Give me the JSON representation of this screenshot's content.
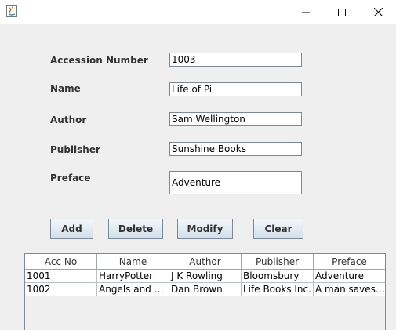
{
  "form": {
    "accession_label": "Accession Number",
    "accession_value": "1003",
    "name_label": "Name",
    "name_value": "Life of Pi",
    "author_label": "Author",
    "author_value": "Sam Wellington",
    "publisher_label": "Publisher",
    "publisher_value": "Sunshine Books",
    "preface_label": "Preface",
    "preface_value": "Adventure"
  },
  "buttons": {
    "add": "Add",
    "delete": "Delete",
    "modify": "Modify",
    "clear": "Clear"
  },
  "table": {
    "columns": [
      "Acc No",
      "Name",
      "Author",
      "Publisher",
      "Preface"
    ],
    "rows": [
      [
        "1001",
        "HarryPotter",
        "J K Rowling",
        "Bloomsbury",
        "Adventure"
      ],
      [
        "1002",
        "Angels and D...",
        "Dan Brown",
        "Life Books Inc.",
        "A man saves t..."
      ]
    ]
  },
  "titlebar": {
    "icons": [
      "java-app-icon",
      "minimize-icon",
      "maximize-icon",
      "close-icon"
    ]
  }
}
